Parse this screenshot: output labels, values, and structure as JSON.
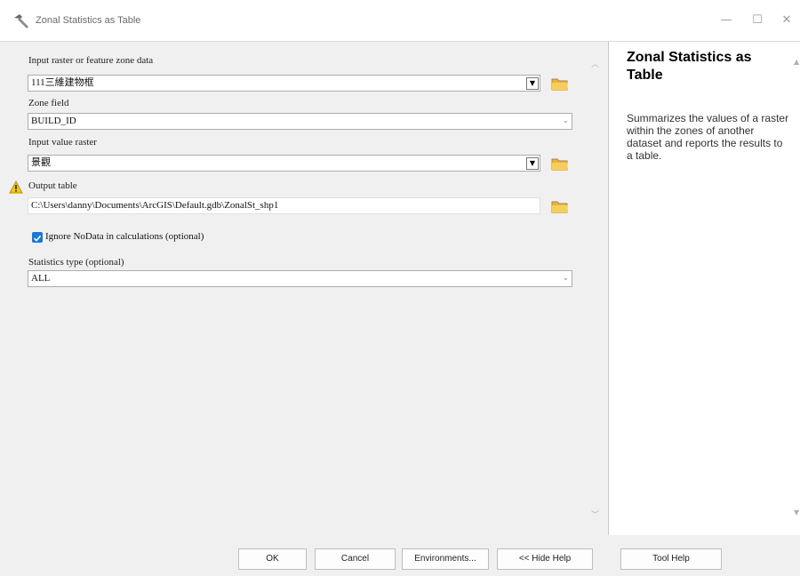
{
  "window": {
    "title": "Zonal Statistics as Table",
    "minimize_glyph": "—",
    "maximize_glyph": "☐",
    "close_glyph": "✕"
  },
  "form": {
    "input_zone_label": "Input raster or feature zone data",
    "input_zone_value": "111三維建物框",
    "zone_field_label": "Zone field",
    "zone_field_value": "BUILD_ID",
    "input_value_label": "Input value raster",
    "input_value_value": "景觀",
    "output_table_label": "Output table",
    "output_table_value": "C:\\Users\\danny\\Documents\\ArcGIS\\Default.gdb\\ZonalSt_shp1",
    "ignore_nodata_label": "Ignore NoData in calculations (optional)",
    "ignore_nodata_checked": true,
    "statistics_type_label": "Statistics type (optional)",
    "statistics_type_value": "ALL",
    "combo_arrow_glyph": "▼",
    "chevron_glyph": "⌄"
  },
  "help": {
    "title": "Zonal Statistics as Table",
    "description": "Summarizes the values of a raster within the zones of another dataset and reports the results to a table."
  },
  "buttons": {
    "ok": "OK",
    "cancel": "Cancel",
    "environments": "Environments...",
    "hide_help": "<< Hide Help",
    "tool_help": "Tool Help"
  },
  "icons": {
    "app": "hammer-icon",
    "warning": "warning-icon",
    "folder": "folder-icon"
  },
  "colors": {
    "folder": "#e9b43a",
    "checkbox": "#1c78d4",
    "warning": "#f2c418"
  }
}
